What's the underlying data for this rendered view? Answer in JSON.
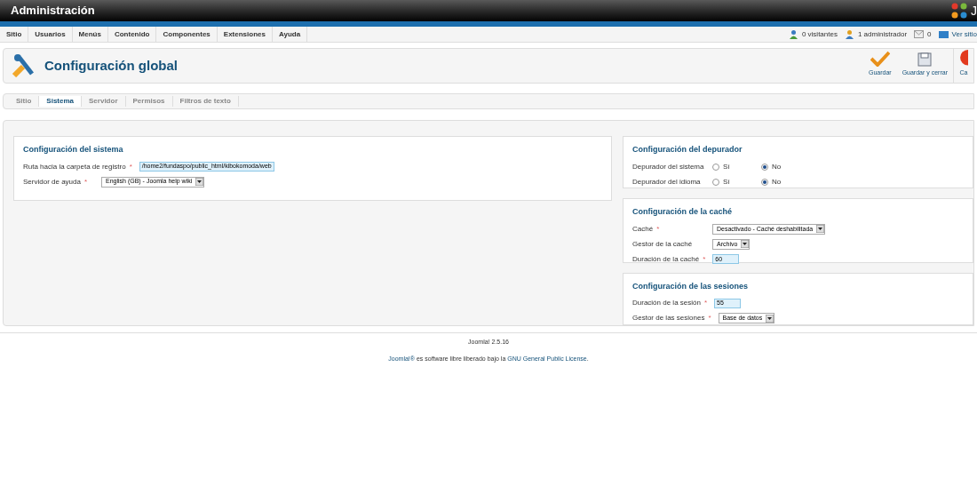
{
  "header": {
    "title": "Administración",
    "logo_text": "J"
  },
  "menu": [
    "Sitio",
    "Usuarios",
    "Menús",
    "Contenido",
    "Componentes",
    "Extensiones",
    "Ayuda"
  ],
  "status": [
    {
      "kind": "visitors",
      "label": "0 visitantes"
    },
    {
      "kind": "admins",
      "label": "1 administrador"
    },
    {
      "kind": "messages",
      "label": "0"
    },
    {
      "kind": "site",
      "label": "Ver sitio"
    }
  ],
  "page_title": "Configuración global",
  "toolbar": [
    {
      "kind": "save",
      "label": "Guardar"
    },
    {
      "kind": "save-close",
      "label": "Guardar y cerrar"
    },
    {
      "kind": "cancel",
      "label": "Ca"
    }
  ],
  "tabs": [
    {
      "label": "Sitio",
      "selected": false
    },
    {
      "label": "Sistema",
      "selected": true
    },
    {
      "label": "Servidor",
      "selected": false
    },
    {
      "label": "Permisos",
      "selected": false
    },
    {
      "label": "Filtros de texto",
      "selected": false
    }
  ],
  "left_panels": [
    {
      "title": "Configuración del sistema",
      "fields": [
        {
          "kind": "text",
          "label": "Ruta hacia la carpeta de registro",
          "required_mark": "*",
          "value": "/home2/fundaspo/public_html/kibokomoda/web",
          "focused": true
        },
        {
          "kind": "select",
          "label": "Servidor de ayuda",
          "required_mark": "*",
          "value": "English (GB) - Joomla help wiki"
        }
      ]
    }
  ],
  "right_panels": [
    {
      "title": "Configuración del depurador",
      "fields": [
        {
          "kind": "radio",
          "label": "Depurador del sistema",
          "options": [
            {
              "label": "Sí",
              "selected": false
            },
            {
              "label": "No",
              "selected": true
            }
          ]
        },
        {
          "kind": "radio",
          "label": "Depurador del idioma",
          "options": [
            {
              "label": "Sí",
              "selected": false
            },
            {
              "label": "No",
              "selected": true
            }
          ]
        }
      ]
    },
    {
      "title": "Configuración de la caché",
      "fields": [
        {
          "kind": "select",
          "label": "Caché",
          "required_mark": "*",
          "value": "Desactivado - Caché deshabilitada"
        },
        {
          "kind": "select",
          "label": "Gestor de la caché",
          "value": "Archivo"
        },
        {
          "kind": "text",
          "label": "Duración de la caché",
          "required_mark": "*",
          "value": "60",
          "focused": true
        }
      ]
    },
    {
      "title": "Configuración de las sesiones",
      "fields": [
        {
          "kind": "text",
          "label": "Duración de la sesión",
          "required_mark": "*",
          "value": "55",
          "focused": true
        },
        {
          "kind": "select",
          "label": "Gestor de las sesiones",
          "required_mark": "*",
          "value": "Base de datos"
        }
      ]
    }
  ],
  "footer": {
    "version": "Joomla! 2.5.16",
    "license_link_1": "Joomla!®",
    "license_text": "es software libre liberado bajo la",
    "license_link_2": "GNU General Public License",
    "license_end": "."
  }
}
